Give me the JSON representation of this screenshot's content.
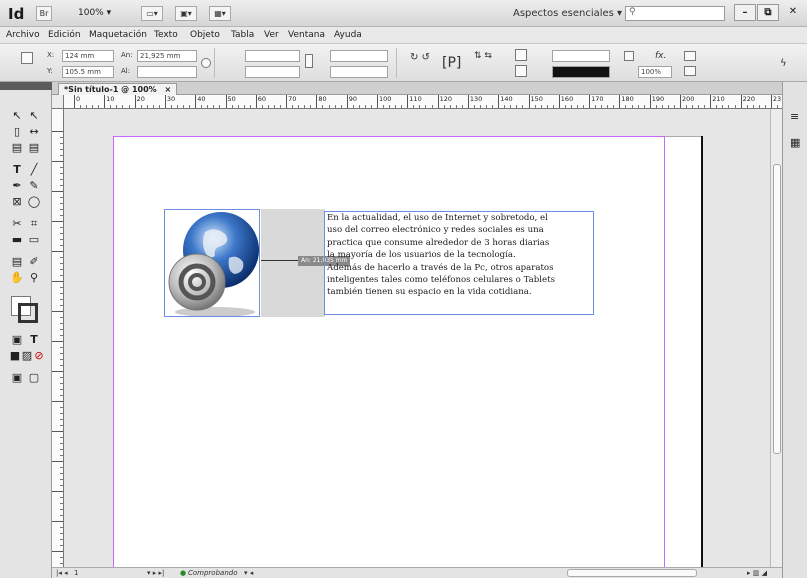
{
  "app": {
    "logo": "Id",
    "bridge_label": "Br",
    "zoom": "100%",
    "workspace": "Aspectos esenciales",
    "search_placeholder": ""
  },
  "menu": [
    "Archivo",
    "Edición",
    "Maquetación",
    "Texto",
    "Objeto",
    "Tabla",
    "Ver",
    "Ventana",
    "Ayuda"
  ],
  "control": {
    "x_label": "X:",
    "x_value": "124 mm",
    "y_label": "Y:",
    "y_value": "105.5 mm",
    "w_label": "An:",
    "w_value": "21,925 mm",
    "h_label": "Al:",
    "h_value": "",
    "scale_value": "100%"
  },
  "document": {
    "tab_title": "*Sin título-1 @ 100%",
    "tab_close": "×",
    "ruler_marks": [
      "0",
      "10",
      "20",
      "30",
      "40",
      "50",
      "60",
      "70",
      "80",
      "90",
      "100",
      "110",
      "120",
      "130",
      "140",
      "150",
      "160",
      "170",
      "180",
      "190",
      "200",
      "210",
      "220",
      "23"
    ],
    "measure_tooltip": "An: 21,035 mm",
    "body_text": [
      "En la actualidad, el uso de Internet y sobretodo, el",
      "uso del correo electrónico y redes sociales es una",
      "practica que consume alrededor de 3 horas diarias",
      "la mayoría de los usuarios de la tecnología.",
      "Además de hacerlo a través de la Pc, otros aparatos",
      "inteligentes tales como teléfonos celulares o Tablets",
      "también tienen su espacio en la vida cotidiana."
    ]
  },
  "status": {
    "page": "1",
    "preflight": "Comprobando"
  }
}
